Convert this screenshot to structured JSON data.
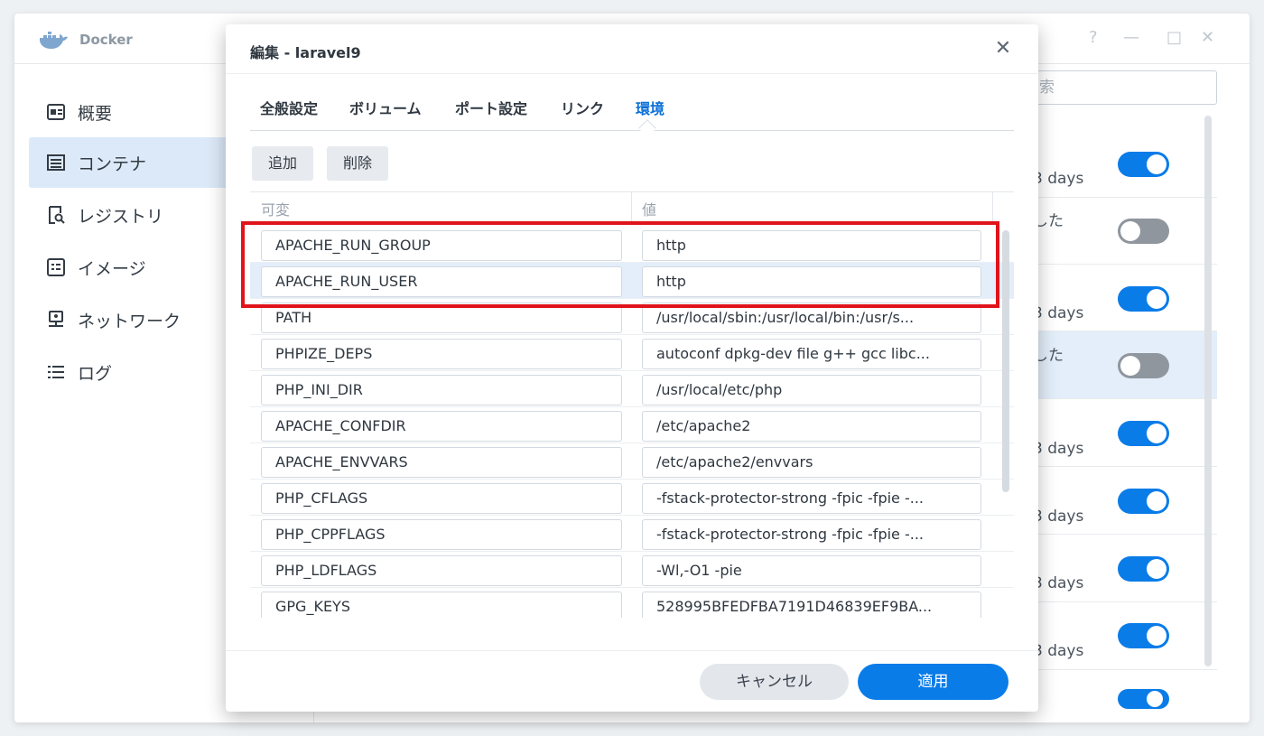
{
  "app": {
    "title": "Docker",
    "help_label": "?",
    "minimize_label": "—",
    "maximize_label": "□",
    "close_label": "✕"
  },
  "sidebar": {
    "items": [
      {
        "label": "概要",
        "icon": "overview-icon"
      },
      {
        "label": "コンテナ",
        "icon": "container-icon"
      },
      {
        "label": "レジストリ",
        "icon": "registry-icon"
      },
      {
        "label": "イメージ",
        "icon": "image-icon"
      },
      {
        "label": "ネットワーク",
        "icon": "network-icon"
      },
      {
        "label": "ログ",
        "icon": "log-icon"
      }
    ],
    "active_index": 1
  },
  "background_list": {
    "search_placeholder": "索",
    "rows": [
      {
        "text": "3 days",
        "toggle": "on"
      },
      {
        "text": "した",
        "toggle": "off"
      },
      {
        "text": "3 days",
        "toggle": "on"
      },
      {
        "text": "した",
        "toggle": "off"
      },
      {
        "text": "3 days",
        "toggle": "on"
      },
      {
        "text": "3 days",
        "toggle": "on"
      },
      {
        "text": "3 days",
        "toggle": "on"
      },
      {
        "text": "3 days",
        "toggle": "on"
      },
      {
        "text": "",
        "toggle": "on"
      }
    ]
  },
  "dialog": {
    "title": "編集 - laravel9",
    "close_label": "✕",
    "tabs": [
      "全般設定",
      "ボリューム",
      "ポート設定",
      "リンク",
      "環境"
    ],
    "active_tab": 4,
    "add_label": "追加",
    "delete_label": "削除",
    "columns": {
      "variable": "可変",
      "value": "値"
    },
    "rows": [
      {
        "variable": "APACHE_RUN_GROUP",
        "value": "http"
      },
      {
        "variable": "APACHE_RUN_USER",
        "value": "http"
      },
      {
        "variable": "PATH",
        "value": "/usr/local/sbin:/usr/local/bin:/usr/s..."
      },
      {
        "variable": "PHPIZE_DEPS",
        "value": "autoconf dpkg-dev file g++ gcc libc..."
      },
      {
        "variable": "PHP_INI_DIR",
        "value": "/usr/local/etc/php"
      },
      {
        "variable": "APACHE_CONFDIR",
        "value": "/etc/apache2"
      },
      {
        "variable": "APACHE_ENVVARS",
        "value": "/etc/apache2/envvars"
      },
      {
        "variable": "PHP_CFLAGS",
        "value": "-fstack-protector-strong -fpic -fpie -..."
      },
      {
        "variable": "PHP_CPPFLAGS",
        "value": "-fstack-protector-strong -fpic -fpie -..."
      },
      {
        "variable": "PHP_LDFLAGS",
        "value": "-Wl,-O1 -pie"
      },
      {
        "variable": "GPG_KEYS",
        "value": "528995BFEDFBA7191D46839EF9BA..."
      }
    ],
    "selected_row": 1,
    "cancel_label": "キャンセル",
    "apply_label": "適用"
  },
  "colors": {
    "accent": "#0a7ce8",
    "highlight_box": "#e0141b",
    "selected_row": "#e3eefa"
  }
}
